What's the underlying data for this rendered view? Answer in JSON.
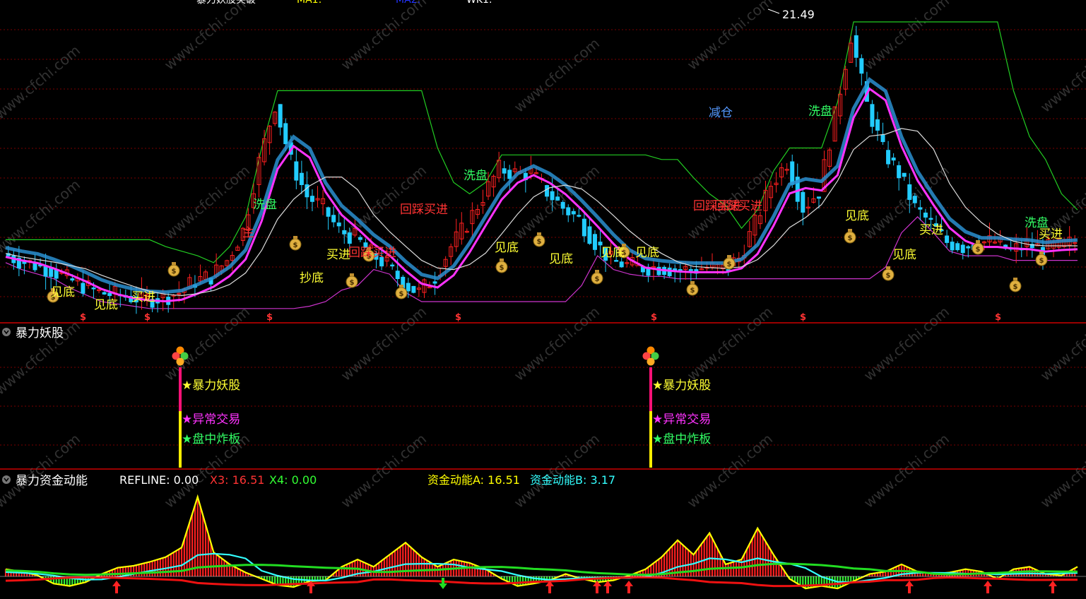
{
  "header": {
    "top_labels": [
      {
        "text": "暴力妖股突破",
        "color": "#ffffff"
      },
      {
        "text": "MA1:",
        "color": "#ffff00"
      },
      {
        "text": "MA2:",
        "color": "#0000ff"
      },
      {
        "text": "WK1:",
        "color": "#ffffff"
      }
    ]
  },
  "main_panel": {
    "peak_price": "21.49",
    "signal_labels": [
      {
        "text": "洗盘",
        "color": "#33ff66"
      },
      {
        "text": "洗盘",
        "color": "#33ff66"
      },
      {
        "text": "洗盘",
        "color": "#33ff66"
      },
      {
        "text": "减仓",
        "color": "#5599ff"
      },
      {
        "text": "回踩买进",
        "color": "#ff3333"
      },
      {
        "text": "回踩买进",
        "color": "#ff3333"
      },
      {
        "text": "回踩买进",
        "color": "#ff3333"
      },
      {
        "text": "回踩买进",
        "color": "#ff3333"
      },
      {
        "text": "买进",
        "color": "#ffff33"
      },
      {
        "text": "买进",
        "color": "#ffff33"
      },
      {
        "text": "买进",
        "color": "#ffff33"
      },
      {
        "text": "买进",
        "color": "#ffff33"
      },
      {
        "text": "见底",
        "color": "#ffff33"
      },
      {
        "text": "见底",
        "color": "#ffff33"
      },
      {
        "text": "见底",
        "color": "#ffff33"
      },
      {
        "text": "见底",
        "color": "#ffff33"
      },
      {
        "text": "见底",
        "color": "#ffff33"
      },
      {
        "text": "见底",
        "color": "#ffff33"
      },
      {
        "text": "见底",
        "color": "#ffff33"
      },
      {
        "text": "抄底",
        "color": "#ffff33"
      },
      {
        "text": "见底",
        "color": "#ffff33"
      },
      {
        "text": "主",
        "color": "#ff3333"
      },
      {
        "text": "洗盘",
        "color": "#33ff66"
      }
    ],
    "dollar_markers": [
      "$",
      "$",
      "$",
      "$",
      "$",
      "$",
      "$"
    ]
  },
  "panel2": {
    "title": "暴力妖股",
    "groups": [
      {
        "labels": [
          "★暴力妖股",
          "★异常交易",
          "★盘中炸板"
        ]
      },
      {
        "labels": [
          "★暴力妖股",
          "★异常交易",
          "★盘中炸板"
        ]
      }
    ],
    "label_colors": [
      "#ffff33",
      "#ff33ff",
      "#33ff66"
    ]
  },
  "panel3": {
    "title": "暴力资金动能",
    "indicators": [
      {
        "text": "REFLINE: 0.00",
        "color": "#ffffff"
      },
      {
        "text": "X3: 16.51",
        "color": "#ff3333"
      },
      {
        "text": "X4: 0.00",
        "color": "#33ff33"
      },
      {
        "text": "资金动能A: 16.51",
        "color": "#ffff00"
      },
      {
        "text": "资金动能B: 3.17",
        "color": "#33ffff"
      }
    ]
  },
  "watermark": "www.cfchi.com",
  "colors": {
    "up": "#ff2020",
    "down": "#22ccff",
    "ma_white": "#dddddd",
    "support_magenta": "#cc33cc",
    "resistance_green": "#22cc22",
    "band_magenta": "#ff33ff",
    "band_blue": "#2a8fd0",
    "grid": "#7a0000",
    "separator": "#cc0000"
  },
  "chart_data": [
    {
      "type": "line",
      "title": "",
      "series": [
        {
          "values": [
            11.5,
            11.2,
            11.0,
            10.8,
            10.4,
            10.1,
            9.8,
            9.7,
            9.6,
            9.5,
            9.6,
            9.8,
            10.3,
            10.5,
            11.2,
            12.5,
            15.5,
            18.0,
            15.5,
            14.0,
            13.5,
            12.5,
            12.2,
            11.5,
            11.0,
            10.2,
            9.8,
            10.5,
            11.8,
            12.8,
            14.0,
            15.2,
            15.0,
            15.0,
            14.2,
            13.5,
            13.0,
            12.0,
            11.2,
            11.0,
            10.9,
            10.9,
            10.8,
            10.8,
            10.9,
            10.8,
            11.3,
            12.8,
            14.5,
            15.5,
            13.5,
            14.2,
            17.5,
            21.0,
            18.0,
            16.0,
            15.0,
            13.5,
            12.8,
            12.0,
            11.8,
            12.0,
            12.0,
            11.6,
            11.9,
            11.7,
            11.8,
            12.0
          ]
        }
      ],
      "ylim": [
        9,
        22
      ]
    },
    {
      "type": "bar",
      "title": "",
      "series": [
        {
          "name": "资金动能A",
          "values": [
            1.5,
            1.0,
            0.2,
            -1.5,
            -2.0,
            -1.2,
            0.5,
            1.8,
            2.2,
            3.0,
            4.0,
            6.0,
            16.5,
            5.0,
            2.5,
            0.8,
            -0.5,
            -1.8,
            -2.2,
            -1.0,
            -0.8,
            2.0,
            3.5,
            2.0,
            4.5,
            7.0,
            4.0,
            2.0,
            3.5,
            2.8,
            1.5,
            -0.5,
            -2.0,
            -1.5,
            -0.8,
            0.5,
            -0.5,
            -1.2,
            -0.8,
            0.2,
            1.5,
            4.0,
            7.5,
            4.5,
            9.0,
            2.5,
            3.5,
            10.0,
            4.5,
            -0.5,
            -2.5,
            -2.0,
            -2.5,
            -1.0,
            0.5,
            1.0,
            2.5,
            1.0,
            0.5,
            0.8,
            1.5,
            1.0,
            -0.5,
            1.5,
            2.0,
            0.5,
            0.2,
            2.0
          ]
        }
      ],
      "ylim": [
        -3,
        17
      ]
    }
  ]
}
